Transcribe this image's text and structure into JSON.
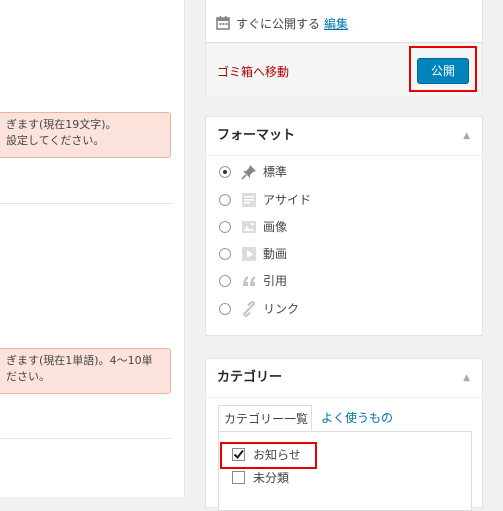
{
  "notices": [
    {
      "line1": "ぎます(現在19文字)。",
      "line2": "設定してください。"
    },
    {
      "line1": "ぎます(現在1単語)。4～10単",
      "line2": "ださい。"
    }
  ],
  "publish": {
    "schedule_label": "すぐに公開する",
    "edit_label": "編集",
    "trash_label": "ゴミ箱へ移動",
    "publish_button": "公開"
  },
  "format": {
    "title": "フォーマット",
    "options": [
      {
        "label": "標準",
        "icon": "pin-icon",
        "selected": true
      },
      {
        "label": "アサイド",
        "icon": "aside-icon",
        "selected": false
      },
      {
        "label": "画像",
        "icon": "image-icon",
        "selected": false
      },
      {
        "label": "動画",
        "icon": "video-icon",
        "selected": false
      },
      {
        "label": "引用",
        "icon": "quote-icon",
        "selected": false
      },
      {
        "label": "リンク",
        "icon": "link-icon",
        "selected": false
      }
    ]
  },
  "category": {
    "title": "カテゴリー",
    "tab_all": "カテゴリー一覧",
    "tab_popular": "よく使うもの",
    "items": [
      {
        "label": "お知らせ",
        "checked": true
      },
      {
        "label": "未分類",
        "checked": false
      }
    ]
  },
  "colors": {
    "accent": "#0085ba",
    "highlight": "#e60000",
    "trash": "#a00000",
    "link": "#0073aa",
    "notice_bg": "#fbe3dc"
  }
}
